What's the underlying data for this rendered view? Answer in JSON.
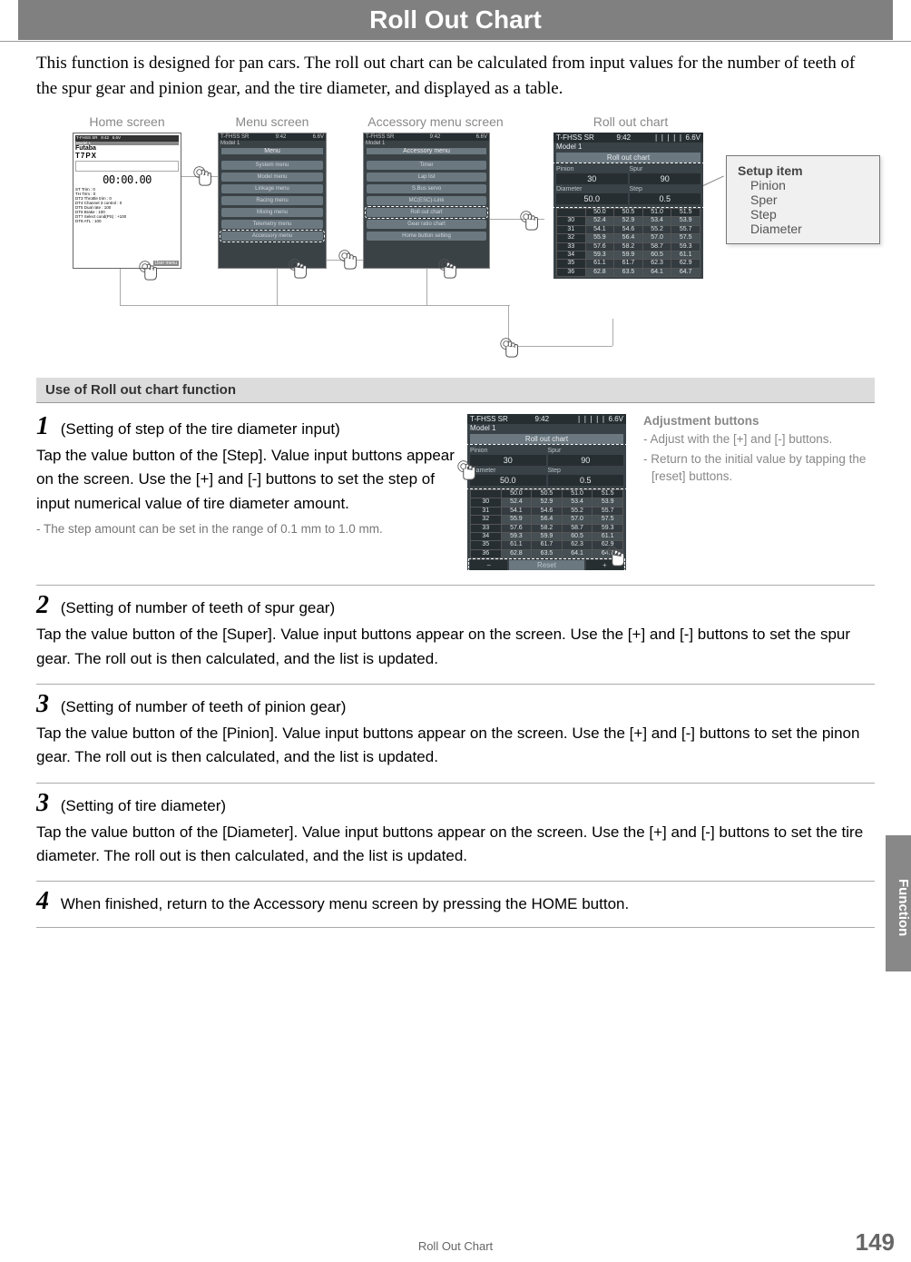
{
  "page": {
    "title": "Roll Out Chart",
    "intro": "This function is designed for pan cars. The roll out chart can be calculated from input values for the number of teeth of the spur gear and pinion gear, and the tire diameter, and displayed as a table.",
    "footer": "Roll Out Chart",
    "page_number": "149",
    "side_tab": "Function"
  },
  "diagram": {
    "labels": {
      "home": "Home screen",
      "menu": "Menu screen",
      "accessory": "Accessory menu screen",
      "rollout": "Roll out chart"
    },
    "home_screen": {
      "brand": "Futaba",
      "model_line": "T7PX",
      "time": "00:00.00"
    },
    "menu_screen": {
      "title": "Menu",
      "items": [
        "System menu",
        "Model menu",
        "Linkage menu",
        "Racing menu",
        "Mixing menu",
        "Telemetry menu",
        "Accessory menu"
      ]
    },
    "accessory_screen": {
      "title": "Accessory menu",
      "items": [
        "Timer",
        "Lap list",
        "S.Bus servo",
        "MC(ESC)-Link",
        "Roll out chart",
        "Gear ratio chart",
        "Home button setting"
      ]
    },
    "setup_box": {
      "head": "Setup item",
      "items": [
        "Pinion",
        "Sper",
        "Step",
        "Diameter"
      ]
    }
  },
  "roll_out_screen": {
    "status": {
      "left": "T-FHSS SR",
      "time": "9:42",
      "batt": "6.6V"
    },
    "model": "Model 1",
    "title": "Roll out chart",
    "params": {
      "pinion": {
        "label": "Pinion",
        "value": "30"
      },
      "spur": {
        "label": "Spur",
        "value": "90"
      },
      "diameter": {
        "label": "Diameter",
        "value": "50.0"
      },
      "step": {
        "label": "Step",
        "value": "0.5"
      }
    },
    "table": {
      "headers": [
        "",
        "50.0",
        "50.5",
        "51.0",
        "51.5"
      ],
      "rows": [
        [
          "30",
          "52.4",
          "52.9",
          "53.4",
          "53.9"
        ],
        [
          "31",
          "54.1",
          "54.6",
          "55.2",
          "55.7"
        ],
        [
          "32",
          "55.9",
          "56.4",
          "57.0",
          "57.5"
        ],
        [
          "33",
          "57.6",
          "58.2",
          "58.7",
          "59.3"
        ],
        [
          "34",
          "59.3",
          "59.9",
          "60.5",
          "61.1"
        ],
        [
          "35",
          "61.1",
          "61.7",
          "62.3",
          "62.9"
        ],
        [
          "36",
          "62.8",
          "63.5",
          "64.1",
          "64.7"
        ]
      ]
    },
    "reset_bar": {
      "minus": "−",
      "reset": "Reset",
      "plus": "+"
    }
  },
  "section_header": "Use of Roll out  chart function",
  "steps": [
    {
      "num": "1",
      "head": "(Setting of step of the tire diameter input)",
      "body": "Tap the value button of the [Step]. Value input buttons appear on the screen. Use the [+] and [-] buttons to set the step of input numerical value of tire diameter amount.",
      "note": "- The step amount can be set in the range of 0.1 mm to 1.0 mm.",
      "adjust": {
        "head": "Adjustment buttons",
        "lines": [
          "- Adjust with the [+] and [-] buttons.",
          "- Return to the initial value by tapping the [reset] buttons."
        ]
      }
    },
    {
      "num": "2",
      "head": "(Setting of number of teeth of spur gear)",
      "body": "Tap the value button of the [Super]. Value input buttons appear on the screen. Use the [+] and [-] buttons to set the spur gear. The roll out is then calculated, and the list is updated."
    },
    {
      "num": "3",
      "head": "(Setting of number of teeth of pinion gear)",
      "body": "Tap the value button of the [Pinion]. Value input buttons appear on the screen. Use the [+] and [-] buttons to set the pinon gear. The roll out is then calculated, and the list is updated."
    },
    {
      "num": "3",
      "head": "(Setting of tire diameter)",
      "body": "Tap the value button of the [Diameter]. Value input buttons appear on the screen. Use the [+] and [-] buttons to set the tire diameter. The roll out is then calculated, and the list is updated."
    },
    {
      "num": "4",
      "head": "When finished, return to the Accessory menu screen by pressing the HOME button.",
      "body": ""
    }
  ]
}
